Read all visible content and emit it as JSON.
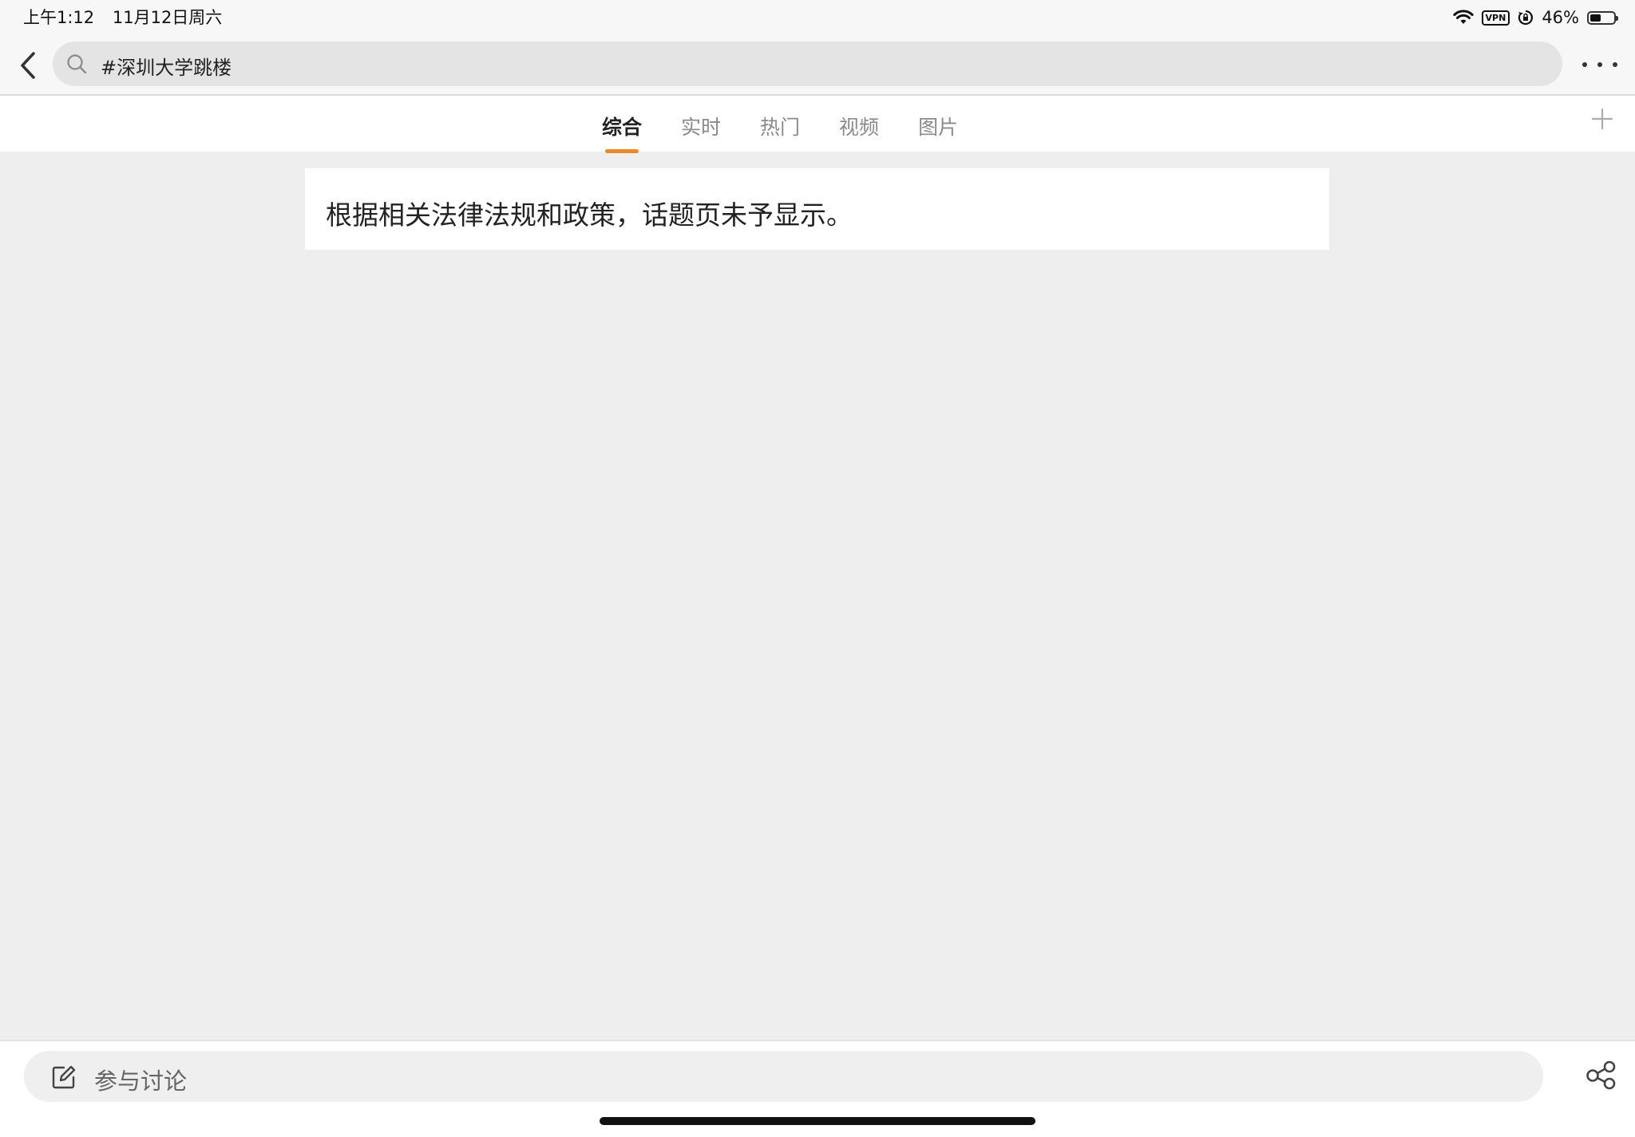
{
  "status_bar": {
    "time": "上午1:12",
    "date": "11月12日周六",
    "vpn_label": "VPN",
    "battery_percent": "46%",
    "battery_level": 0.46,
    "icons": [
      "wifi-icon",
      "vpn-icon",
      "rotation-lock-icon",
      "battery-icon"
    ]
  },
  "search": {
    "query": "#深圳大学跳楼",
    "icons": [
      "back-icon",
      "search-icon",
      "more-icon"
    ]
  },
  "tabs": [
    {
      "label": "综合",
      "active": true
    },
    {
      "label": "实时",
      "active": false
    },
    {
      "label": "热门",
      "active": false
    },
    {
      "label": "视频",
      "active": false
    },
    {
      "label": "图片",
      "active": false
    }
  ],
  "tab_bar": {
    "add_icon": "plus-icon"
  },
  "notice": {
    "text": "根据相关法律法规和政策，话题页未予显示。"
  },
  "bottom_bar": {
    "comment_placeholder": "参与讨论",
    "icons": [
      "edit-icon",
      "share-icon"
    ]
  },
  "colors": {
    "accent": "#e98a2a",
    "background": "#eeeeee",
    "card": "#ffffff",
    "inactive_tab": "#8a8a8a"
  }
}
